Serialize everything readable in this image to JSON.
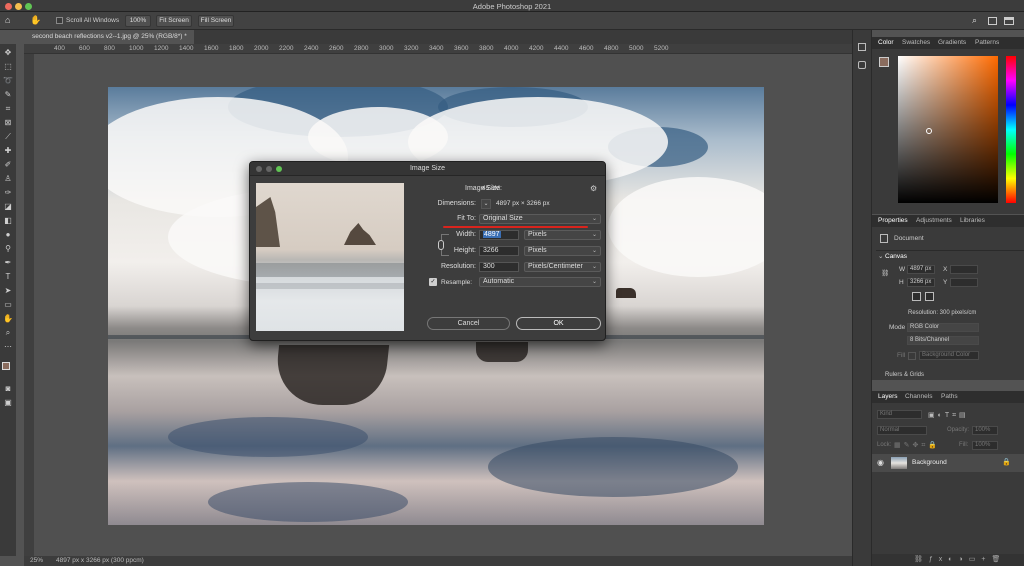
{
  "app": {
    "title": "Adobe Photoshop 2021"
  },
  "options_bar": {
    "scroll_all_label": "Scroll All Windows",
    "zoom_100": "100%",
    "fit_screen": "Fit Screen",
    "fill_screen": "Fill Screen"
  },
  "document": {
    "tab_title": "second beach reflections v2--1.jpg @ 25% (RGB/8*) *"
  },
  "ruler": {
    "marks": [
      "400",
      "600",
      "800",
      "1000",
      "1200",
      "1400",
      "1600",
      "1800",
      "2000",
      "2200",
      "2400",
      "2600",
      "2800",
      "3000",
      "3200",
      "3400",
      "3600",
      "3800",
      "4000",
      "4200",
      "4400",
      "4600",
      "4800",
      "5000",
      "5200"
    ]
  },
  "status": {
    "zoom": "25%",
    "info": "4897 px x 3266 px (300 ppcm)"
  },
  "dialog": {
    "title": "Image Size",
    "image_size_label": "Image Size:",
    "image_size_value": "45.8M",
    "dimensions_label": "Dimensions:",
    "dimensions_value": "4897 px  ×  3266 px",
    "fit_to_label": "Fit To:",
    "fit_to_value": "Original Size",
    "width_label": "Width:",
    "width_value": "4897",
    "width_unit": "Pixels",
    "height_label": "Height:",
    "height_value": "3266",
    "height_unit": "Pixels",
    "resolution_label": "Resolution:",
    "resolution_value": "300",
    "resolution_unit": "Pixels/Centimeter",
    "resample_label": "Resample:",
    "resample_value": "Automatic",
    "cancel": "Cancel",
    "ok": "OK"
  },
  "color_panel": {
    "tabs": [
      "Color",
      "Swatches",
      "Gradients",
      "Patterns"
    ]
  },
  "properties_panel": {
    "tabs": [
      "Properties",
      "Adjustments",
      "Libraries"
    ],
    "document_label": "Document",
    "canvas_label": "Canvas",
    "w_label": "W",
    "w_value": "4897 px",
    "x_label": "X",
    "h_label": "H",
    "h_value": "3266 px",
    "y_label": "Y",
    "resolution_text": "Resolution: 300 pixels/cm",
    "mode_label": "Mode",
    "mode_value": "RGB Color",
    "bits_value": "8 Bits/Channel",
    "fill_label": "Fill",
    "fill_value": "Background Color",
    "rulers_label": "Rulers & Grids"
  },
  "layers_panel": {
    "tabs": [
      "Layers",
      "Channels",
      "Paths"
    ],
    "kind_label": "Kind",
    "blend_value": "Normal",
    "opacity_label": "Opacity:",
    "opacity_value": "100%",
    "lock_label": "Lock:",
    "fill_label": "Fill:",
    "fill_value": "100%",
    "layer_name": "Background"
  },
  "colors": {
    "accent_red": "#d9241d",
    "fg_swatch": "#8a6c5e",
    "selection": "#3a6fb5"
  }
}
